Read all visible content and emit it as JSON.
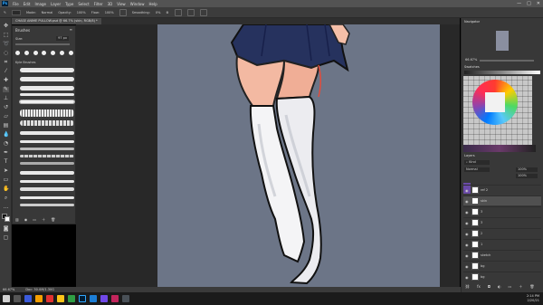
{
  "app": {
    "logo": "Ps",
    "menu": [
      "File",
      "Edit",
      "Image",
      "Layer",
      "Type",
      "Select",
      "Filter",
      "3D",
      "View",
      "Window",
      "Help"
    ],
    "window_controls": [
      "—",
      "□",
      "✕"
    ]
  },
  "options": {
    "mode_label": "Mode:",
    "mode_value": "Normal",
    "opacity_label": "Opacity:",
    "opacity_value": "100%",
    "flow_label": "Flow:",
    "flow_value": "100%",
    "smoothing_label": "Smoothing:",
    "smoothing_value": "0%"
  },
  "document": {
    "tab_title": "CHASE ANIME PULLOW.psd @ 66.7% (skin, RGB/8) *"
  },
  "brushes_panel": {
    "title": "Brushes",
    "size_label": "Size:",
    "size_value": "97 px",
    "folder_label": "Kyle Brushes"
  },
  "status": {
    "zoom": "66.67%",
    "doc_info": "Doc: 30.0M/1.30G"
  },
  "right": {
    "navigator_tab": "Navigator",
    "zoom_readout": "66.67%",
    "swatches_tab": "Swatches",
    "layers_tab": "Layers",
    "blend_mode": "Normal",
    "opacity": "100%",
    "fill": "100%",
    "layers": [
      {
        "name": "ref 2"
      },
      {
        "name": "skin"
      },
      {
        "name": "3"
      },
      {
        "name": "3"
      },
      {
        "name": "2"
      },
      {
        "name": "1"
      },
      {
        "name": "sketch"
      },
      {
        "name": "bg"
      },
      {
        "name": "bg"
      }
    ]
  },
  "taskbar": {
    "time": "2:14 PM",
    "date": "2/20/21"
  }
}
